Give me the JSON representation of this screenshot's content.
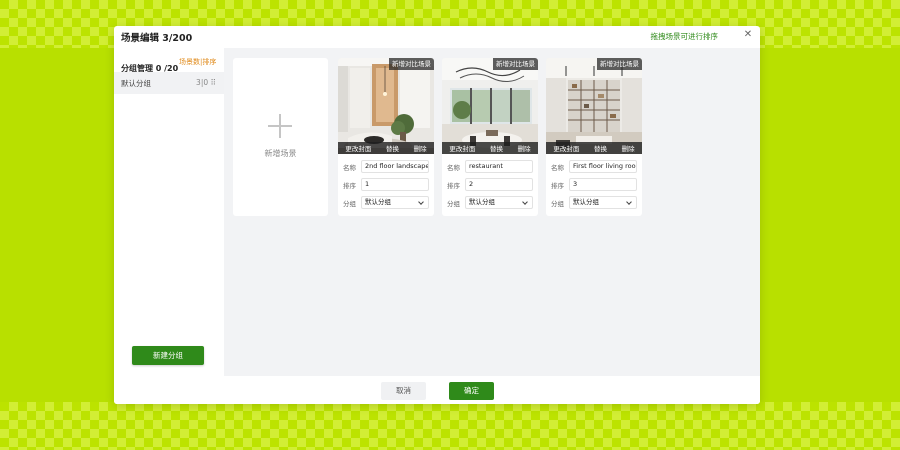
{
  "modal": {
    "title": "场景编辑 3/200",
    "drag_hint": "拖拽场景可进行排序",
    "close_icon": "close-icon"
  },
  "sidebar": {
    "group_title": "分组管理 0 /20",
    "group_sort": "场景数|排序",
    "groups": [
      {
        "label": "默认分组",
        "count": "3|0 ⠿"
      }
    ],
    "new_group_label": "新建分组"
  },
  "main": {
    "add_scene_label": "新增场景",
    "scenes": [
      {
        "add_compare": "新增对比场景",
        "actions": [
          "更改封面",
          "替换",
          "删除"
        ],
        "name_label": "名称",
        "name": "2nd floor landscape",
        "order_label": "排序",
        "order": "1",
        "group_label": "分组",
        "group": "默认分组"
      },
      {
        "add_compare": "新增对比场景",
        "actions": [
          "更改封面",
          "替换",
          "删除"
        ],
        "name_label": "名称",
        "name": "restaurant",
        "order_label": "排序",
        "order": "2",
        "group_label": "分组",
        "group": "默认分组"
      },
      {
        "add_compare": "新增对比场景",
        "actions": [
          "更改封面",
          "替换",
          "删除"
        ],
        "name_label": "名称",
        "name": "First floor living room",
        "order_label": "排序",
        "order": "3",
        "group_label": "分组",
        "group": "默认分组"
      }
    ]
  },
  "footer": {
    "cancel_label": "取消",
    "ok_label": "确定"
  },
  "colors": {
    "background": "#b8e000",
    "primary": "#2f8a1a",
    "accent_orange": "#e08a1a"
  }
}
